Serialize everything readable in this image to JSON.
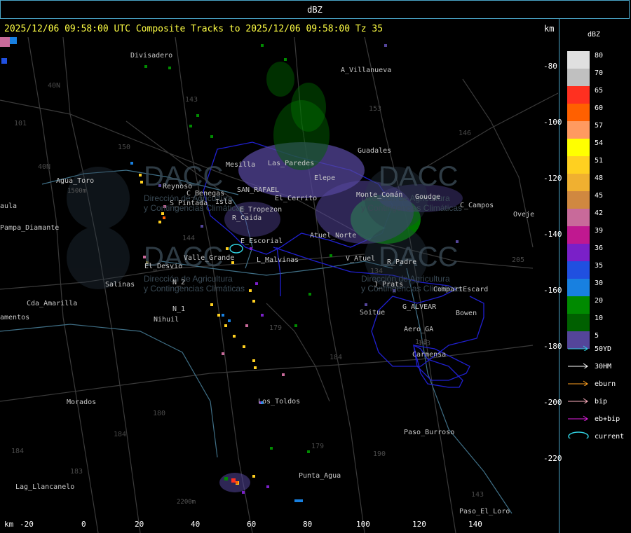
{
  "window_title": "dBZ",
  "header": {
    "text": "2025/12/06 09:58:00 UTC Composite Tracks to 2025/12/06 09:58:00 Tz 35",
    "km_label_top": "km",
    "km_label_bottom": "km"
  },
  "axes": {
    "x_ticks": [
      "-20",
      "0",
      "20",
      "40",
      "60",
      "80",
      "100",
      "120",
      "140"
    ],
    "y_ticks": [
      "-80",
      "-100",
      "-120",
      "-140",
      "-160",
      "-180",
      "-200",
      "-220"
    ]
  },
  "legend": {
    "title": "dBZ",
    "levels": [
      {
        "label": "80",
        "color": "#e0e0e0"
      },
      {
        "label": "70",
        "color": "#c0c0c0"
      },
      {
        "label": "65",
        "color": "#ff3020"
      },
      {
        "label": "60",
        "color": "#ff6000"
      },
      {
        "label": "57",
        "color": "#ff9a60"
      },
      {
        "label": "54",
        "color": "#ffff00"
      },
      {
        "label": "51",
        "color": "#ffd020"
      },
      {
        "label": "48",
        "color": "#f0b030"
      },
      {
        "label": "45",
        "color": "#d08840"
      },
      {
        "label": "42",
        "color": "#c86a9a"
      },
      {
        "label": "39",
        "color": "#c01890"
      },
      {
        "label": "36",
        "color": "#7a20c8"
      },
      {
        "label": "35",
        "color": "#2050e0"
      },
      {
        "label": "30",
        "color": "#1880e0"
      },
      {
        "label": "20",
        "color": "#008a00"
      },
      {
        "label": "10",
        "color": "#006000"
      },
      {
        "label": "5",
        "color": "#54459a"
      }
    ],
    "tracks": [
      {
        "label": "50YD",
        "color": "#30d0e0"
      },
      {
        "label": "30HM",
        "color": "#ffffff"
      },
      {
        "label": "eburn",
        "color": "#ffa020"
      },
      {
        "label": "bip",
        "color": "#ffb0c0"
      },
      {
        "label": "eb+bip",
        "color": "#e020e0"
      },
      {
        "label": "current",
        "color": "#30d0e0"
      }
    ]
  },
  "places": [
    "Divisadero",
    "A_Villanueva",
    "Guadales",
    "Agua_Toro",
    "Reynoso",
    "Pampa_Diamante",
    "C_Benegas",
    "SAN_RAFAEL",
    "R_Caida",
    "E_Escorial",
    "Atuel_Norte",
    "Valle_Grande",
    "L_Malvinas",
    "V_Atuel",
    "El_Desvio",
    "Salinas",
    "N_2",
    "N_1",
    "Nihuil",
    "Cda_Amarilla",
    "Soitue",
    "G_ALVEAR",
    "Bowen",
    "CompartEscard",
    "Aero_GA",
    "Carmensa",
    "Los_Toldos",
    "Morados",
    "Paso_Burroso",
    "Punta_Agua",
    "Lag_Llancanelo",
    "Paso_El_Loro",
    "C_Campos",
    "Oveje",
    "R_Padre",
    "J_Prats",
    "S_Pintada",
    "Goudge",
    "Elepe",
    "Mesilla",
    "Las_Paredes",
    "El_Cerrito",
    "E_Tropezon",
    "Isla",
    "Monte_Comán",
    "aula",
    "amentos"
  ],
  "road_numbers": [
    "143",
    "153",
    "146",
    "150",
    "40N",
    "40N",
    "101",
    "144",
    "134",
    "179",
    "184",
    "180",
    "184",
    "183",
    "179",
    "190",
    "143",
    "143",
    "143",
    "205",
    "184"
  ],
  "map_annotations": [
    "1500m",
    "2200m"
  ],
  "watermark": {
    "brand": "DACC",
    "subtitle_lines": [
      "Dirección de Agricultura",
      "y Contingencias Climáticas"
    ]
  }
}
